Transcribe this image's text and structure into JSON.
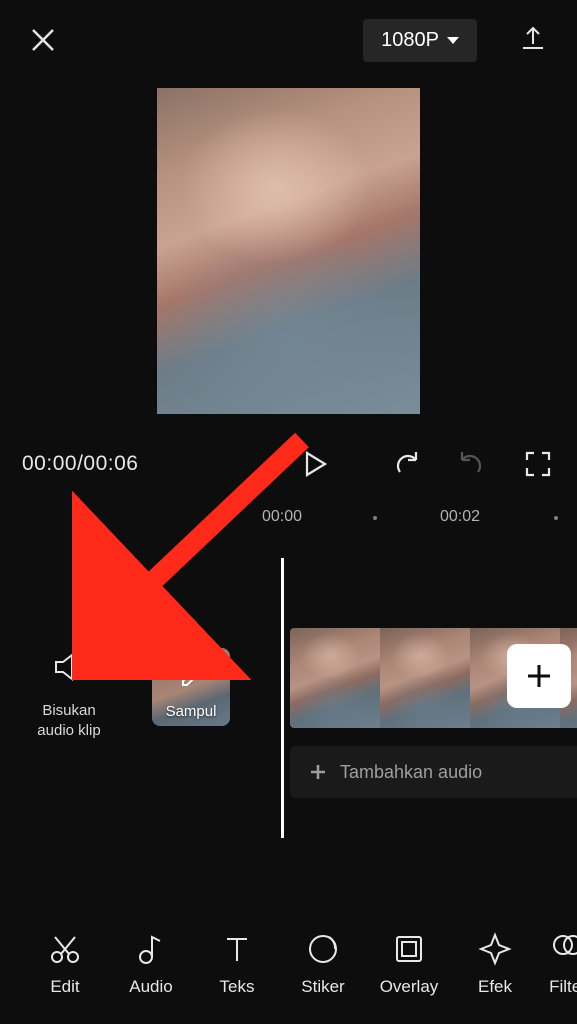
{
  "header": {
    "resolution_label": "1080P"
  },
  "playback": {
    "current_time": "00:00",
    "total_time": "00:06"
  },
  "ruler": {
    "t0": "00:00",
    "t1": "00:02"
  },
  "tools": {
    "mute_label": "Bisukan audio klip",
    "cover_label": "Sampul"
  },
  "audio_row": {
    "add_label": "Tambahkan audio"
  },
  "bottom": {
    "edit": "Edit",
    "audio": "Audio",
    "teks": "Teks",
    "stiker": "Stiker",
    "overlay": "Overlay",
    "efek": "Efek",
    "filter": "Filter"
  }
}
